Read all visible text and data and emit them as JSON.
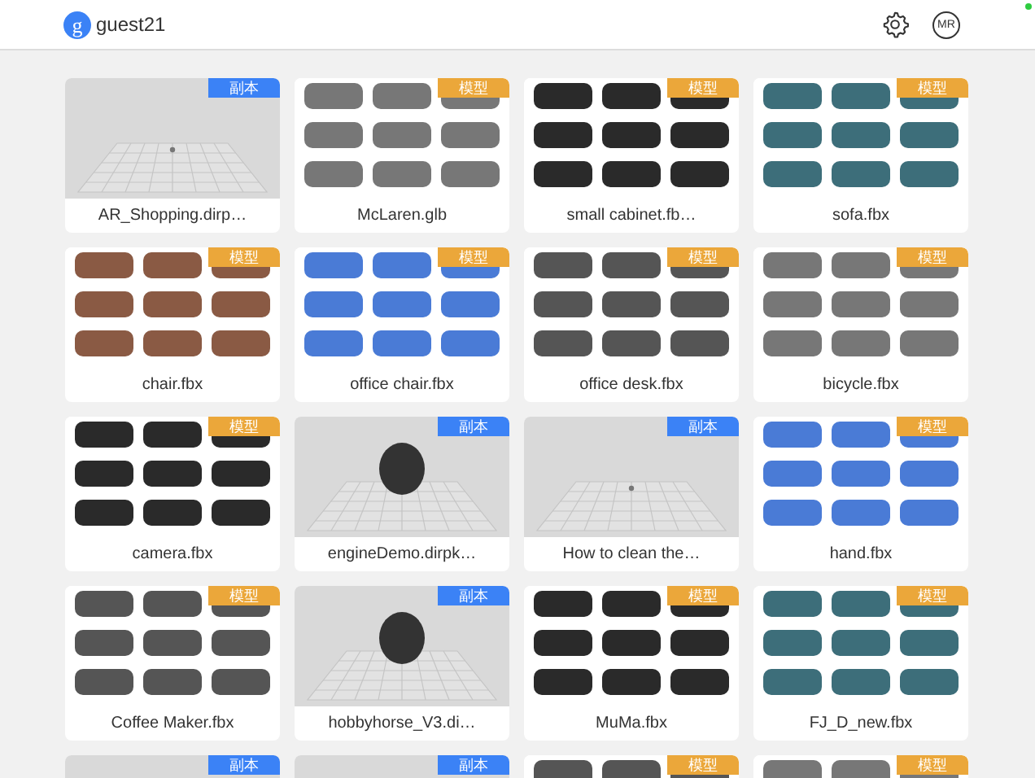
{
  "header": {
    "avatar": "g",
    "username": "guest21",
    "mode_button": "MR"
  },
  "cards": [
    {
      "kind": "scene",
      "badge": "副本",
      "name": "AR_Shopping.dirp…"
    },
    {
      "kind": "model",
      "badge": "模型",
      "name": "McLaren.glb"
    },
    {
      "kind": "model",
      "badge": "模型",
      "name": "small cabinet.fb…"
    },
    {
      "kind": "model",
      "badge": "模型",
      "name": "sofa.fbx"
    },
    {
      "kind": "model",
      "badge": "模型",
      "name": "chair.fbx"
    },
    {
      "kind": "model",
      "badge": "模型",
      "name": "office chair.fbx"
    },
    {
      "kind": "model",
      "badge": "模型",
      "name": "office desk.fbx"
    },
    {
      "kind": "model",
      "badge": "模型",
      "name": "bicycle.fbx"
    },
    {
      "kind": "model",
      "badge": "模型",
      "name": "camera.fbx"
    },
    {
      "kind": "scene",
      "badge": "副本",
      "name": "engineDemo.dirpk…"
    },
    {
      "kind": "scene",
      "badge": "副本",
      "name": "How to clean the…"
    },
    {
      "kind": "model",
      "badge": "模型",
      "name": "hand.fbx"
    },
    {
      "kind": "model",
      "badge": "模型",
      "name": "Coffee Maker.fbx"
    },
    {
      "kind": "scene",
      "badge": "副本",
      "name": "hobbyhorse_V3.di…"
    },
    {
      "kind": "model",
      "badge": "模型",
      "name": "MuMa.fbx"
    },
    {
      "kind": "model",
      "badge": "模型",
      "name": "FJ_D_new.fbx"
    },
    {
      "kind": "scene",
      "badge": "副本"
    },
    {
      "kind": "scene",
      "badge": "副本"
    },
    {
      "kind": "model",
      "badge": "模型"
    },
    {
      "kind": "model",
      "badge": "模型"
    }
  ]
}
